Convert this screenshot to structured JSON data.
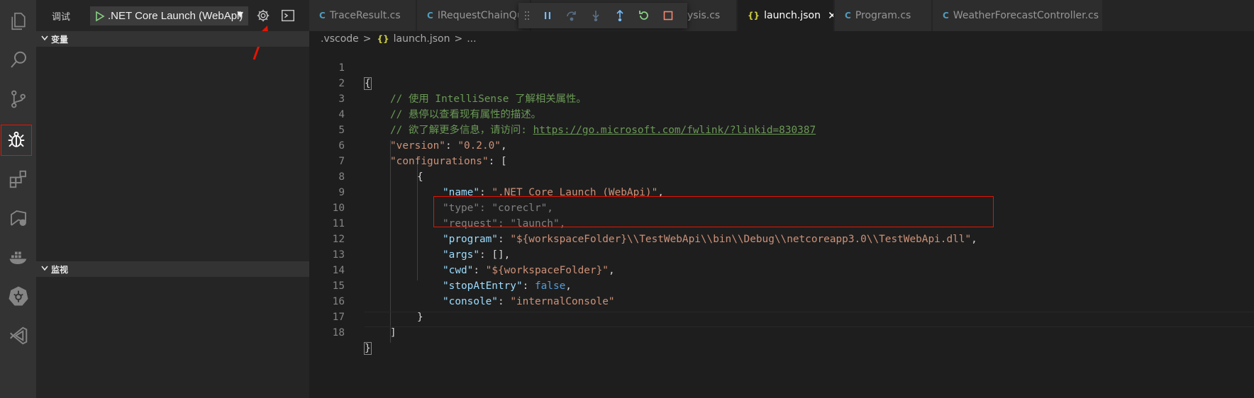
{
  "debug": {
    "title": "调试",
    "config_name": ".NET Core Launch (WebApi)",
    "caret": "▼"
  },
  "sidebar": {
    "variables_label": "变量",
    "watch_label": "监视"
  },
  "tabs": [
    {
      "label": "TraceResult.cs",
      "icon": "C#"
    },
    {
      "label": "IRequestChainQu",
      "icon": "C#"
    },
    {
      "label": "ysis.cs",
      "icon": ""
    },
    {
      "label": "launch.json",
      "icon": "{}",
      "active": true,
      "close": "✕"
    },
    {
      "label": "Program.cs",
      "icon": "C#"
    },
    {
      "label": "WeatherForecastController.cs",
      "icon": "C#"
    }
  ],
  "breadcrumb": {
    "folder": ".vscode",
    "sep": ">",
    "file_icon": "{}",
    "file": "launch.json",
    "tail": "..."
  },
  "code": {
    "line_numbers": [
      "1",
      "2",
      "3",
      "4",
      "5",
      "6",
      "7",
      "8",
      "9",
      "10",
      "11",
      "12",
      "13",
      "14",
      "15",
      "16",
      "17",
      "18"
    ],
    "comment1": "// 使用 IntelliSense 了解相关属性。",
    "comment2": "// 悬停以查看现有属性的描述。",
    "comment3_prefix": "// 欲了解更多信息，请访问: ",
    "comment3_link": "https://go.microsoft.com/fwlink/?linkid=830387",
    "version_key": "\"version\"",
    "version_val": "\"0.2.0\"",
    "configurations_key": "\"configurations\"",
    "name_key": "\"name\"",
    "name_val": "\".NET Core Launch (WebApi)\"",
    "type_key": "\"type\"",
    "type_val": "\"coreclr\"",
    "request_key": "\"request\"",
    "request_val": "\"launch\"",
    "program_key": "\"program\"",
    "program_val": "\"${workspaceFolder}\\\\TestWebApi\\\\bin\\\\Debug\\\\netcoreapp3.0\\\\TestWebApi.dll\"",
    "args_key": "\"args\"",
    "args_val": "[]",
    "cwd_key": "\"cwd\"",
    "cwd_val": "\"${workspaceFolder}\"",
    "stop_key": "\"stopAtEntry\"",
    "stop_val": "false",
    "console_key": "\"console\"",
    "console_val": "\"internalConsole\""
  },
  "colors": {
    "accent_annotation": "#e51400",
    "string": "#ce9178",
    "key": "#9cdcfe",
    "comment": "#6a9955",
    "keyword": "#569cd6"
  }
}
